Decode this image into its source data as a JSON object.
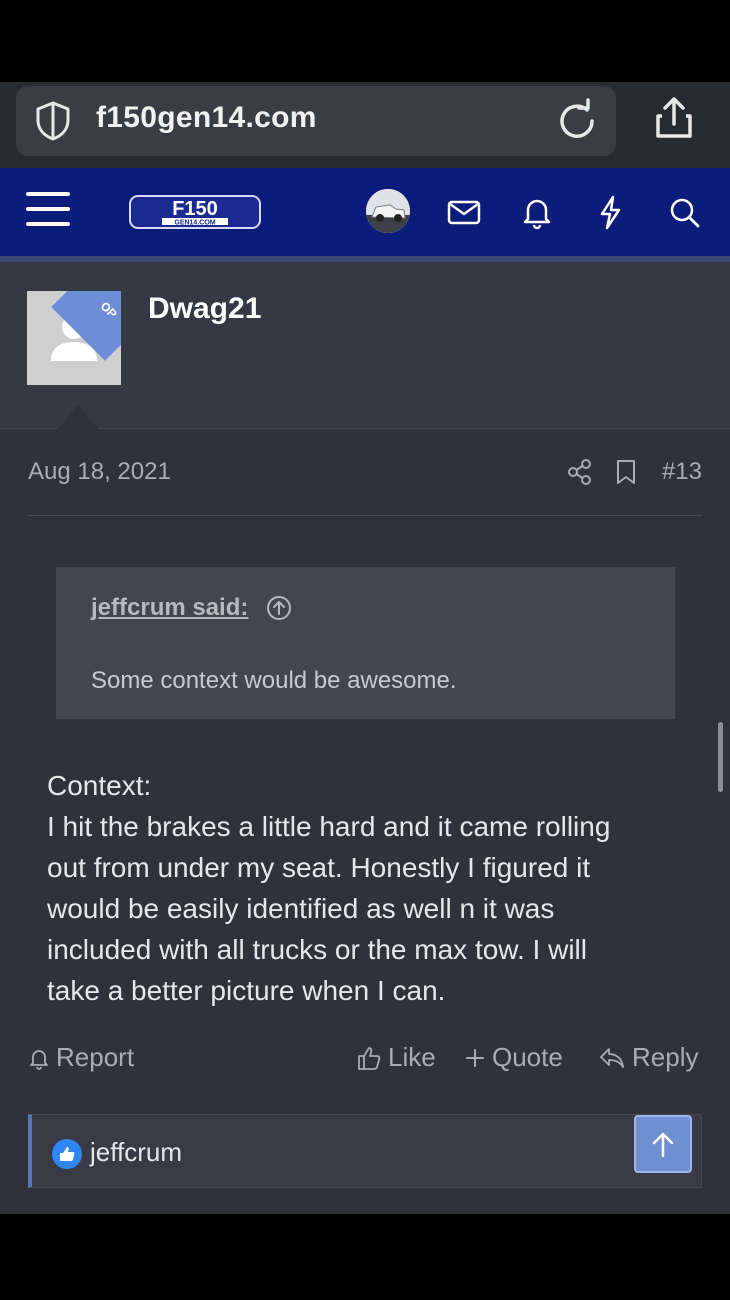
{
  "browser": {
    "domain": "f150gen14.com"
  },
  "header": {
    "logo_text": "F150",
    "logo_subtext": "GEN14.COM"
  },
  "post": {
    "username": "Dwag21",
    "op_badge": "OP",
    "date": "Aug 18, 2021",
    "post_number": "#13",
    "quote": {
      "author": "jeffcrum said:",
      "text": "Some context would be awesome."
    },
    "body": "Context:\nI hit the brakes a little hard and it came rolling\nout from under my seat. Honestly I figured it\nwould be easily identified as well n it was\nincluded with all trucks or the max tow. I will\ntake a better picture when I can.",
    "actions": {
      "report": "Report",
      "like": "Like",
      "quote": "Quote",
      "reply": "Reply"
    },
    "reactions": {
      "user": "jeffcrum"
    }
  },
  "colors": {
    "header_bg": "#0c1c7b",
    "page_bg": "#2f323b",
    "accent": "#6f8fd3",
    "like_badge": "#2f86f5"
  }
}
